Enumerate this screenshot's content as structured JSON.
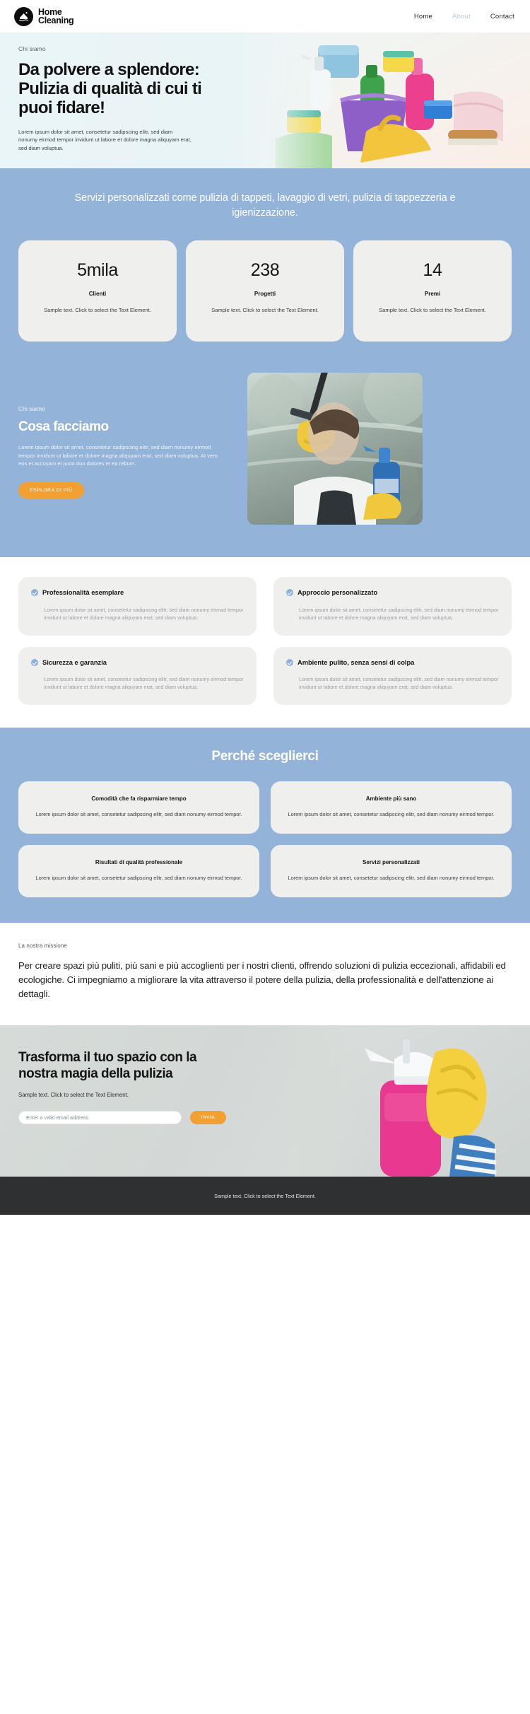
{
  "brand": {
    "name": "Home\nCleaning",
    "icon": "house-logo-icon"
  },
  "nav": {
    "items": [
      {
        "label": "Home",
        "state": "active"
      },
      {
        "label": "About",
        "state": "muted"
      },
      {
        "label": "Contact",
        "state": "active"
      }
    ]
  },
  "hero": {
    "eyebrow": "Chi siamo",
    "heading": "Da polvere a splendore: Pulizia di qualità di cui ti puoi fidare!",
    "paragraph": "Lorem ipsum dolor sit amet, consetetur sadipscing elitr, sed diam nonumy eirmod tempor invidunt ut labore et dolore magna aliquyam erat, sed diam voluptua."
  },
  "services_band": {
    "tagline": "Servizi personalizzati come pulizia di tappeti, lavaggio di vetri, pulizia di tappezzeria e igienizzazione.",
    "stats": [
      {
        "number": "5mila",
        "label": "Clienti",
        "description": "Sample text. Click to select the Text Element."
      },
      {
        "number": "238",
        "label": "Progetti",
        "description": "Sample text. Click to select the Text Element."
      },
      {
        "number": "14",
        "label": "Premi",
        "description": "Sample text. Click to select the Text Element."
      }
    ]
  },
  "about": {
    "eyebrow": "Chi siamo",
    "heading": "Cosa facciamo",
    "paragraph": "Lorem ipsum dolor sit amet, consetetur sadipscing elitr, sed diam nonumy eirmod tempor invidunt ut labore et dolore magna aliquyam erat, sed diam voluptua. At vero eos et accusam et justo duo dolores et ea rebum.",
    "button": "ESPLORA DI PIÙ",
    "image": "window-cleaning-squeegee-photo"
  },
  "features": [
    {
      "title": "Professionalità esemplare",
      "body": "Lorem ipsum dolor sit amet, consetetur sadipscing elitr, sed diam nonumy eirmod tempor invidunt ut labore et dolore magna aliquyam erat, sed diam voluptua."
    },
    {
      "title": "Approccio personalizzato",
      "body": "Lorem ipsum dolor sit amet, consetetur sadipscing elitr, sed diam nonumy eirmod tempor invidunt ut labore et dolore magna aliquyam erat, sed diam voluptua."
    },
    {
      "title": "Sicurezza e garanzia",
      "body": "Lorem ipsum dolor sit amet, consetetur sadipscing elitr, sed diam nonumy eirmod tempor invidunt ut labore et dolore magna aliquyam erat, sed diam voluptua."
    },
    {
      "title": "Ambiente pulito, senza sensi di colpa",
      "body": "Lorem ipsum dolor sit amet, consetetur sadipscing elitr, sed diam nonumy eirmod tempor invidunt ut labore et dolore magna aliquyam erat, sed diam voluptua."
    }
  ],
  "why": {
    "heading": "Perché sceglierci",
    "cards": [
      {
        "title": "Comodità che fa risparmiare tempo",
        "body": "Lorem ipsum dolor sit amet, consetetur sadipscing elitr, sed diam nonumy eirmod tempor."
      },
      {
        "title": "Ambiente più sano",
        "body": "Lorem ipsum dolor sit amet, consetetur sadipscing elitr, sed diam nonumy eirmod tempor."
      },
      {
        "title": "Risultati di qualità professionale",
        "body": "Lorem ipsum dolor sit amet, consetetur sadipscing elitr, sed diam nonumy eirmod tempor."
      },
      {
        "title": "Servizi personalizzati",
        "body": "Lorem ipsum dolor sit amet, consetetur sadipscing elitr, sed diam nonumy eirmod tempor."
      }
    ]
  },
  "mission": {
    "eyebrow": "La nostra missione",
    "text": "Per creare spazi più puliti, più sani e più accoglienti per i nostri clienti, offrendo soluzioni di pulizia eccezionali, affidabili ed ecologiche. Ci impegniamo a migliorare la vita attraverso il potere della pulizia, della professionalità e dell'attenzione ai dettagli."
  },
  "cta": {
    "heading": "Trasforma il tuo spazio con la nostra magia della pulizia",
    "subtext": "Sample text. Click to select the Text Element.",
    "email_placeholder": "Enter a valid email address",
    "email_value": "",
    "submit_label": "INVIA",
    "image": "spray-bottle-yellow-glove-photo"
  },
  "footer": {
    "text": "Sample text. Click to select the Text Element."
  },
  "colors": {
    "blue": "#94b3d9",
    "orange": "#f2a032",
    "card": "#efefee",
    "footer": "#2f3032",
    "ink": "#141414"
  }
}
